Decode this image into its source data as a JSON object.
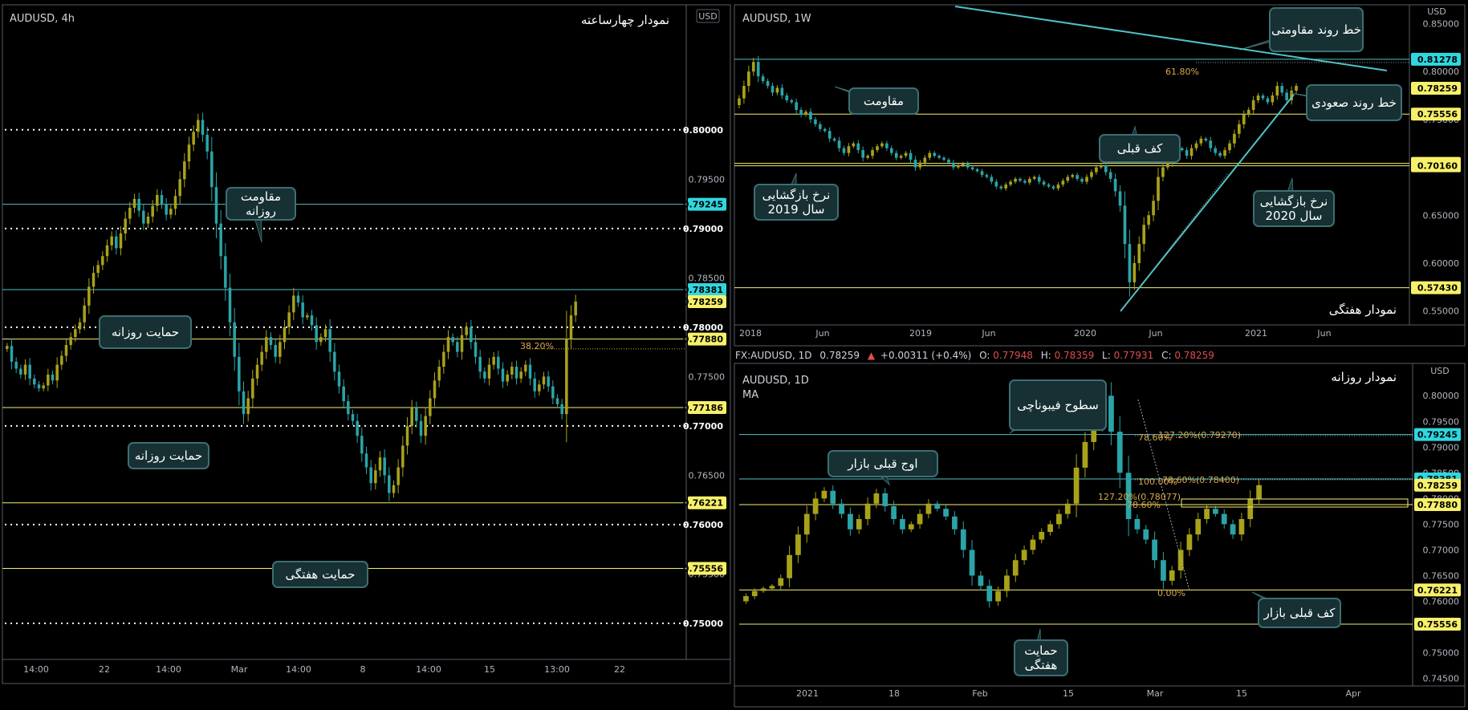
{
  "colors": {
    "bull": "#a8a21b",
    "bear": "#2ba4a7",
    "yellow_line": "#f5f070",
    "cyan_line": "#4fc3c7",
    "cyan_badge": "#2fd7e0",
    "yellow_badge": "#f7f06a",
    "box_fill": "#173033",
    "box_stroke": "#3c6f72",
    "fib_text": "#d9a84a"
  },
  "chart_data": [
    {
      "id": "h4",
      "type": "candlestick",
      "symbol": "AUDUSD, 4h",
      "title": "نمودار چهارساعته",
      "currency": "USD",
      "y_ticks": [
        "0.80000",
        "0.79500",
        "0.79000",
        "0.78500",
        "0.78000",
        "0.77500",
        "0.77000",
        "0.76500",
        "0.76000",
        "0.75500",
        "0.75000"
      ],
      "ylim": [
        0.7465,
        0.8125
      ],
      "x_ticks": [
        "14:00",
        "22",
        "14:00",
        "Mar",
        "14:00",
        "8",
        "14:00",
        "15",
        "13:00",
        "22"
      ],
      "series": {
        "start": 0.7778,
        "points": [
          0.7781,
          0.7765,
          0.7758,
          0.7752,
          0.7762,
          0.7748,
          0.7742,
          0.7738,
          0.7741,
          0.7752,
          0.7746,
          0.7762,
          0.7771,
          0.7782,
          0.779,
          0.7798,
          0.7805,
          0.7822,
          0.7841,
          0.7855,
          0.7863,
          0.7872,
          0.7883,
          0.7892,
          0.788,
          0.7895,
          0.791,
          0.7921,
          0.793,
          0.7918,
          0.7905,
          0.7912,
          0.7923,
          0.7934,
          0.7925,
          0.7914,
          0.792,
          0.7933,
          0.795,
          0.7968,
          0.7985,
          0.7998,
          0.801,
          0.7995,
          0.7978,
          0.7942,
          0.7905,
          0.7872,
          0.784,
          0.7805,
          0.777,
          0.7735,
          0.7712,
          0.7728,
          0.7748,
          0.7762,
          0.7775,
          0.779,
          0.7782,
          0.777,
          0.7785,
          0.78,
          0.7815,
          0.7832,
          0.7825,
          0.781,
          0.7812,
          0.7802,
          0.7785,
          0.779,
          0.7798,
          0.7775,
          0.7755,
          0.774,
          0.7725,
          0.7712,
          0.7705,
          0.769,
          0.7672,
          0.7658,
          0.7642,
          0.7655,
          0.7668,
          0.765,
          0.7632,
          0.764,
          0.7658,
          0.768,
          0.77,
          0.7718,
          0.7705,
          0.769,
          0.771,
          0.7728,
          0.7746,
          0.776,
          0.7775,
          0.779,
          0.7785,
          0.7775,
          0.7792,
          0.78,
          0.7785,
          0.777,
          0.7755,
          0.7748,
          0.7762,
          0.777,
          0.7758,
          0.7745,
          0.7752,
          0.776,
          0.7748,
          0.7755,
          0.7762,
          0.7748,
          0.7735,
          0.7742,
          0.775,
          0.774,
          0.7728,
          0.7722,
          0.7712,
          0.7788,
          0.7812,
          0.7826
        ]
      },
      "levels": [
        {
          "label": "0.80000",
          "value": 0.8,
          "style": "dot",
          "badge": "white"
        },
        {
          "label": "0.79245",
          "value": 0.79245,
          "style": "cyan",
          "badge": "cyan"
        },
        {
          "label": "0.79000",
          "value": 0.79,
          "style": "dot",
          "badge": "white"
        },
        {
          "label": "0.78381",
          "value": 0.78381,
          "style": "cyan",
          "badge": "cyan"
        },
        {
          "label": "0.78259",
          "value": 0.78259,
          "style": "none",
          "badge": "yellow"
        },
        {
          "label": "0.78000",
          "value": 0.78,
          "style": "dot",
          "badge": "white"
        },
        {
          "label": "0.77880",
          "value": 0.7788,
          "style": "yellow",
          "badge": "yellow"
        },
        {
          "label": "0.77186",
          "value": 0.77186,
          "style": "yellow",
          "badge": "yellow"
        },
        {
          "label": "0.77000",
          "value": 0.77,
          "style": "dot",
          "badge": "white"
        },
        {
          "label": "0.76221",
          "value": 0.76221,
          "style": "yellow",
          "badge": "yellow"
        },
        {
          "label": "0.76000",
          "value": 0.76,
          "style": "dot",
          "badge": "white"
        },
        {
          "label": "0.75556",
          "value": 0.75556,
          "style": "yellow",
          "badge": "yellow"
        },
        {
          "label": "0.75000",
          "value": 0.75,
          "style": "dot",
          "badge": "white"
        }
      ],
      "fib_labels": [
        "38.20%"
      ],
      "annotations": [
        "مقاومت\nروزانه",
        "حمایت روزانه",
        "حمایت روزانه",
        "حمایت هفتگی"
      ]
    },
    {
      "id": "w1",
      "type": "candlestick",
      "symbol": "AUDUSD, 1W",
      "title": "نمودار هفتگی",
      "currency": "USD",
      "y_ticks": [
        "0.85000",
        "0.80000",
        "0.75000",
        "0.70000",
        "0.65000",
        "0.60000",
        "0.55000"
      ],
      "ylim": [
        0.538,
        0.868
      ],
      "x_ticks": [
        "2018",
        "Jun",
        "2019",
        "Jun",
        "2020",
        "Jun",
        "2021",
        "Jun"
      ],
      "series": {
        "start": 0.765,
        "points": [
          0.772,
          0.785,
          0.8,
          0.81,
          0.795,
          0.79,
          0.785,
          0.778,
          0.783,
          0.775,
          0.77,
          0.768,
          0.76,
          0.755,
          0.758,
          0.75,
          0.745,
          0.74,
          0.738,
          0.73,
          0.728,
          0.72,
          0.715,
          0.722,
          0.725,
          0.718,
          0.71,
          0.712,
          0.718,
          0.722,
          0.725,
          0.72,
          0.715,
          0.71,
          0.712,
          0.715,
          0.708,
          0.7,
          0.705,
          0.71,
          0.715,
          0.712,
          0.71,
          0.708,
          0.705,
          0.7,
          0.702,
          0.704,
          0.7,
          0.698,
          0.696,
          0.692,
          0.69,
          0.685,
          0.68,
          0.678,
          0.682,
          0.685,
          0.688,
          0.686,
          0.684,
          0.688,
          0.69,
          0.685,
          0.682,
          0.68,
          0.678,
          0.682,
          0.686,
          0.69,
          0.692,
          0.688,
          0.685,
          0.69,
          0.695,
          0.7,
          0.702,
          0.695,
          0.688,
          0.675,
          0.66,
          0.62,
          0.58,
          0.6,
          0.62,
          0.64,
          0.65,
          0.665,
          0.69,
          0.7,
          0.705,
          0.715,
          0.72,
          0.718,
          0.712,
          0.72,
          0.725,
          0.73,
          0.728,
          0.72,
          0.715,
          0.712,
          0.718,
          0.725,
          0.735,
          0.745,
          0.755,
          0.76,
          0.77,
          0.775,
          0.772,
          0.768,
          0.775,
          0.785,
          0.778,
          0.77,
          0.78,
          0.785
        ]
      },
      "levels": [
        {
          "label": "0.81278",
          "value": 0.81278,
          "style": "cyan",
          "badge": "cyan"
        },
        {
          "label": "0.78259",
          "value": 0.78259,
          "style": "none",
          "badge": "yellow"
        },
        {
          "label": "0.75556",
          "value": 0.75556,
          "style": "yellow",
          "badge": "yellow"
        },
        {
          "label": "0.70420",
          "value": 0.7042,
          "style": "yellow",
          "badge": "yellow"
        },
        {
          "label": "0.70160",
          "value": 0.7016,
          "style": "yellow",
          "badge": "yellow"
        },
        {
          "label": "0.57430",
          "value": 0.5743,
          "style": "yellow",
          "badge": "yellow"
        }
      ],
      "fib_labels": [
        "61.80%"
      ],
      "annotations": [
        "خط روند مقاومتی",
        "مقاومت",
        "خط روند صعودی",
        "کف قبلی",
        "نرخ بازگشایی\nسال 2019",
        "نرخ بازگشایی\nسال 2020"
      ]
    },
    {
      "id": "d1",
      "type": "candlestick",
      "symbol": "AUDUSD, 1D",
      "title": "نمودار روزانه",
      "indicator": "MA",
      "currency": "USD",
      "y_ticks": [
        "0.80000",
        "0.79500",
        "0.79000",
        "0.78500",
        "0.78000",
        "0.77500",
        "0.77000",
        "0.76500",
        "0.76000",
        "0.75500",
        "0.75000",
        "0.74500"
      ],
      "ylim": [
        0.744,
        0.8055
      ],
      "x_ticks": [
        "2021",
        "18",
        "Feb",
        "15",
        "Mar",
        "15",
        "Apr"
      ],
      "series": {
        "start": 0.76,
        "points": [
          0.761,
          0.762,
          0.7625,
          0.763,
          0.7645,
          0.769,
          0.773,
          0.777,
          0.78,
          0.7815,
          0.779,
          0.777,
          0.774,
          0.776,
          0.779,
          0.781,
          0.7785,
          0.776,
          0.774,
          0.775,
          0.777,
          0.779,
          0.778,
          0.7765,
          0.774,
          0.77,
          0.765,
          0.763,
          0.76,
          0.762,
          0.765,
          0.768,
          0.77,
          0.772,
          0.7735,
          0.775,
          0.777,
          0.779,
          0.786,
          0.791,
          0.795,
          0.8,
          0.793,
          0.785,
          0.776,
          0.774,
          0.772,
          0.768,
          0.764,
          0.766,
          0.77,
          0.773,
          0.776,
          0.778,
          0.777,
          0.775,
          0.773,
          0.776,
          0.78,
          0.7826
        ]
      },
      "levels": [
        {
          "label": "0.79245",
          "value": 0.79245,
          "style": "cyan",
          "badge": "cyan"
        },
        {
          "label": "0.78381",
          "value": 0.78381,
          "style": "cyan",
          "badge": "cyan"
        },
        {
          "label": "0.78259",
          "value": 0.78259,
          "style": "none",
          "badge": "yellow"
        },
        {
          "label": "0.77880",
          "value": 0.7788,
          "style": "yellow",
          "badge": "yellow"
        },
        {
          "label": "0.76221",
          "value": 0.76221,
          "style": "yellow",
          "badge": "yellow"
        },
        {
          "label": "0.75556",
          "value": 0.75556,
          "style": "yellow",
          "badge": "yellow"
        }
      ],
      "fib_labels": [
        "127.20%(0.79270)",
        "78.60%",
        "100.00%",
        "78.60%(0.78400)",
        "127.20%(0.78077)",
        "78.60%",
        "0.00%"
      ],
      "annotations": [
        "سطوح فیبوناچی",
        "اوج قبلی بازار",
        "کف قبلی بازار",
        "حمایت\nهفتگی"
      ]
    }
  ],
  "quote_bar": {
    "symbol": "FX:AUDUSD, 1D",
    "last": "0.78259",
    "change": "+0.00311 (+0.4%)",
    "o_label": "O:",
    "o": "0.77948",
    "h_label": "H:",
    "h": "0.78359",
    "l_label": "L:",
    "l": "0.77931",
    "c_label": "C:",
    "c": "0.78259"
  }
}
